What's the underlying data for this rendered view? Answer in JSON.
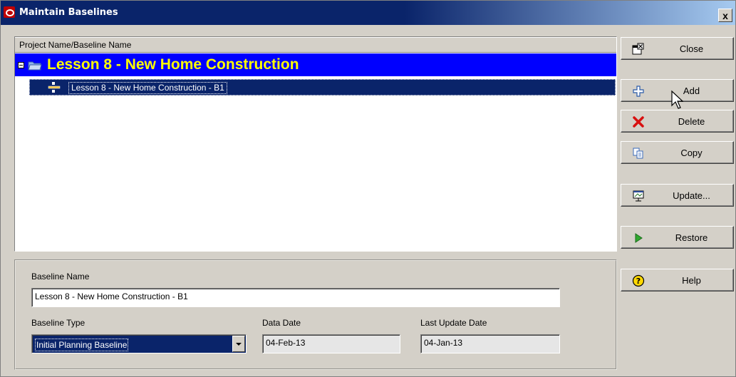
{
  "window": {
    "title": "Maintain Baselines",
    "close_glyph": "x"
  },
  "tree": {
    "column_header": "Project Name/Baseline Name",
    "project": {
      "label": "Lesson 8 - New Home Construction",
      "icon": "folder-open-icon"
    },
    "baseline": {
      "label": "Lesson 8 - New Home Construction - B1",
      "icon": "baseline-icon"
    }
  },
  "buttons": [
    {
      "label": "Close",
      "icon": "close-window-icon"
    },
    {
      "label": "Add",
      "icon": "add-icon"
    },
    {
      "label": "Delete",
      "icon": "delete-icon"
    },
    {
      "label": "Copy",
      "icon": "copy-icon"
    },
    {
      "label": "Update...",
      "icon": "update-icon"
    },
    {
      "label": "Restore",
      "icon": "restore-icon"
    },
    {
      "label": "Help",
      "icon": "help-icon"
    }
  ],
  "details": {
    "baseline_name_label": "Baseline Name",
    "baseline_name_value": "Lesson 8 - New Home Construction - B1",
    "baseline_type_label": "Baseline Type",
    "baseline_type_value": "Initial Planning Baseline",
    "data_date_label": "Data Date",
    "data_date_value": "04-Feb-13",
    "last_update_label": "Last Update Date",
    "last_update_value": "04-Jan-13"
  },
  "colors": {
    "title_bar": "#0a246a",
    "project_row": "#0000ff",
    "project_text": "#ffff00",
    "selection": "#0a246a"
  }
}
